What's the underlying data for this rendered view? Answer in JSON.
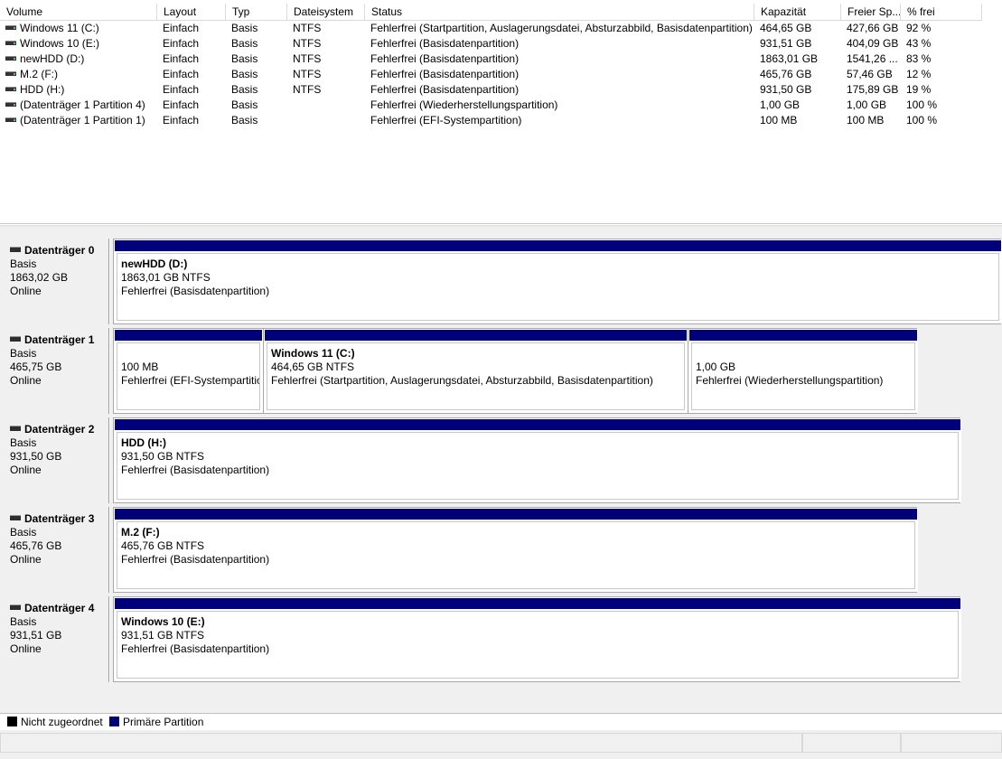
{
  "volume_table": {
    "columns": [
      "Volume",
      "Layout",
      "Typ",
      "Dateisystem",
      "Status",
      "Kapazität",
      "Freier Sp...",
      "% frei"
    ],
    "rows": [
      [
        "Windows 11 (C:)",
        "Einfach",
        "Basis",
        "NTFS",
        "Fehlerfrei (Startpartition, Auslagerungsdatei, Absturzabbild, Basisdatenpartition)",
        "464,65 GB",
        "427,66 GB",
        "92 %"
      ],
      [
        "Windows 10 (E:)",
        "Einfach",
        "Basis",
        "NTFS",
        "Fehlerfrei (Basisdatenpartition)",
        "931,51 GB",
        "404,09 GB",
        "43 %"
      ],
      [
        "newHDD (D:)",
        "Einfach",
        "Basis",
        "NTFS",
        "Fehlerfrei (Basisdatenpartition)",
        "1863,01 GB",
        "1541,26 ...",
        "83 %"
      ],
      [
        "M.2 (F:)",
        "Einfach",
        "Basis",
        "NTFS",
        "Fehlerfrei (Basisdatenpartition)",
        "465,76 GB",
        "57,46 GB",
        "12 %"
      ],
      [
        "HDD (H:)",
        "Einfach",
        "Basis",
        "NTFS",
        "Fehlerfrei (Basisdatenpartition)",
        "931,50 GB",
        "175,89 GB",
        "19 %"
      ],
      [
        "(Datenträger 1 Partition 4)",
        "Einfach",
        "Basis",
        "",
        "Fehlerfrei (Wiederherstellungspartition)",
        "1,00 GB",
        "1,00 GB",
        "100 %"
      ],
      [
        "(Datenträger 1 Partition 1)",
        "Einfach",
        "Basis",
        "",
        "Fehlerfrei (EFI-Systempartition)",
        "100 MB",
        "100 MB",
        "100 %"
      ]
    ]
  },
  "disks": [
    {
      "name": "Datenträger 0",
      "type": "Basis",
      "size": "1863,02 GB",
      "state": "Online",
      "partitions": [
        {
          "name": "newHDD  (D:)",
          "size": "1863,01 GB NTFS",
          "status": "Fehlerfrei (Basisdatenpartition)"
        }
      ]
    },
    {
      "name": "Datenträger 1",
      "type": "Basis",
      "size": "465,75 GB",
      "state": "Online",
      "partitions": [
        {
          "name": "",
          "size": "100 MB",
          "status": "Fehlerfrei (EFI-Systempartitic"
        },
        {
          "name": "Windows 11  (C:)",
          "size": "464,65 GB NTFS",
          "status": "Fehlerfrei (Startpartition, Auslagerungsdatei, Absturzabbild, Basisdatenpartition)"
        },
        {
          "name": "",
          "size": "1,00 GB",
          "status": "Fehlerfrei (Wiederherstellungspartition)"
        }
      ]
    },
    {
      "name": "Datenträger 2",
      "type": "Basis",
      "size": "931,50 GB",
      "state": "Online",
      "partitions": [
        {
          "name": "HDD  (H:)",
          "size": "931,50 GB NTFS",
          "status": "Fehlerfrei (Basisdatenpartition)"
        }
      ]
    },
    {
      "name": "Datenträger 3",
      "type": "Basis",
      "size": "465,76 GB",
      "state": "Online",
      "partitions": [
        {
          "name": "M.2  (F:)",
          "size": "465,76 GB NTFS",
          "status": "Fehlerfrei (Basisdatenpartition)"
        }
      ]
    },
    {
      "name": "Datenträger 4",
      "type": "Basis",
      "size": "931,51 GB",
      "state": "Online",
      "partitions": [
        {
          "name": "Windows 10  (E:)",
          "size": "931,51 GB NTFS",
          "status": "Fehlerfrei (Basisdatenpartition)"
        }
      ]
    }
  ],
  "legend": {
    "unallocated": "Nicht zugeordnet",
    "unallocated_color": "#000000",
    "primary": "Primäre Partition",
    "primary_color": "#00007a"
  },
  "icons": {
    "volume": "drive-icon",
    "disk": "disk-icon"
  }
}
